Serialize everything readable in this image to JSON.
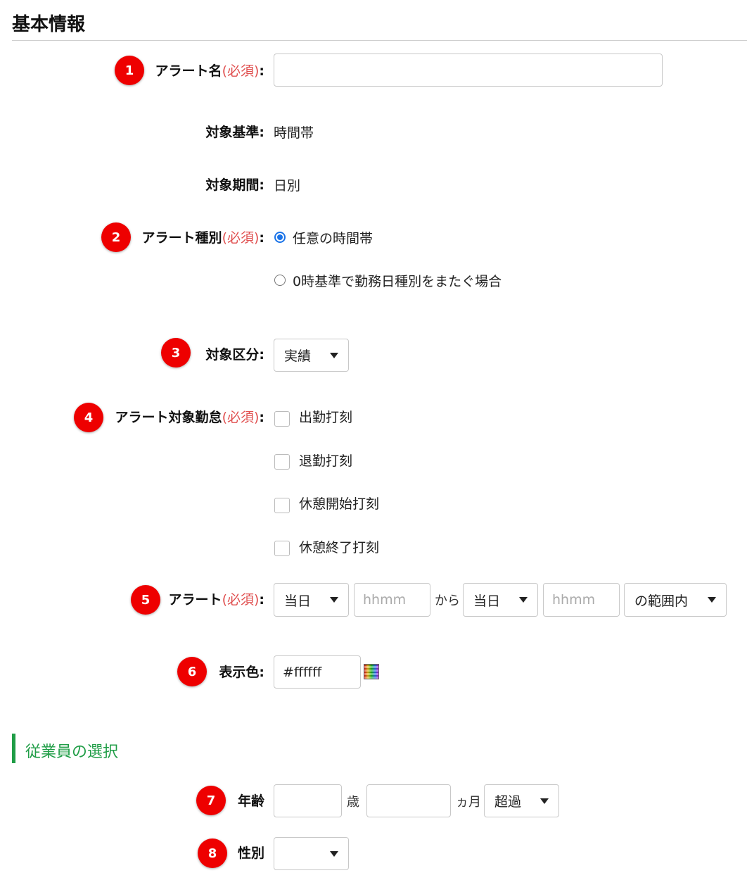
{
  "page": {
    "heading": "基本情報",
    "section2_heading": "従業員の選択"
  },
  "badges": [
    "1",
    "2",
    "3",
    "4",
    "5",
    "6",
    "7",
    "8"
  ],
  "alert_name": {
    "label": "アラート名",
    "required": "(必須)",
    "colon": ":",
    "value": ""
  },
  "target_basis": {
    "label": "対象基準:",
    "value": "時間帯"
  },
  "target_period": {
    "label": "対象期間:",
    "value": "日別"
  },
  "alert_type": {
    "label": "アラート種別",
    "required": "(必須)",
    "colon": ":",
    "options": [
      "任意の時間帯",
      "0時基準で勤務日種別をまたぐ場合"
    ],
    "selected_index": 0
  },
  "target_category": {
    "label": "対象区分:",
    "selected": "実績"
  },
  "alert_attendance": {
    "label": "アラート対象勤怠",
    "required": "(必須)",
    "colon": ":",
    "options": [
      "出勤打刻",
      "退勤打刻",
      "休憩開始打刻",
      "休憩終了打刻"
    ],
    "checked": [
      false,
      false,
      false,
      false
    ]
  },
  "alert_time": {
    "label": "アラート",
    "required": "(必須)",
    "colon": ":",
    "from_day": "当日",
    "from_placeholder": "hhmm",
    "connector": "から",
    "to_day": "当日",
    "to_placeholder": "hhmm",
    "range": "の範囲内"
  },
  "display_color": {
    "label": "表示色:",
    "value": "#ffffff",
    "palette_icon": "color-palette-icon"
  },
  "employee": {
    "age_label": "年齢",
    "age_unit": "歳",
    "month_unit": "ヵ月",
    "age_condition": "超過",
    "gender_label": "性別",
    "gender_selected": ""
  },
  "colors": {
    "badge": "#ee0000",
    "required_text": "#e05050",
    "section_accent": "#1f9d46",
    "radio_selected": "#1a73e8"
  }
}
